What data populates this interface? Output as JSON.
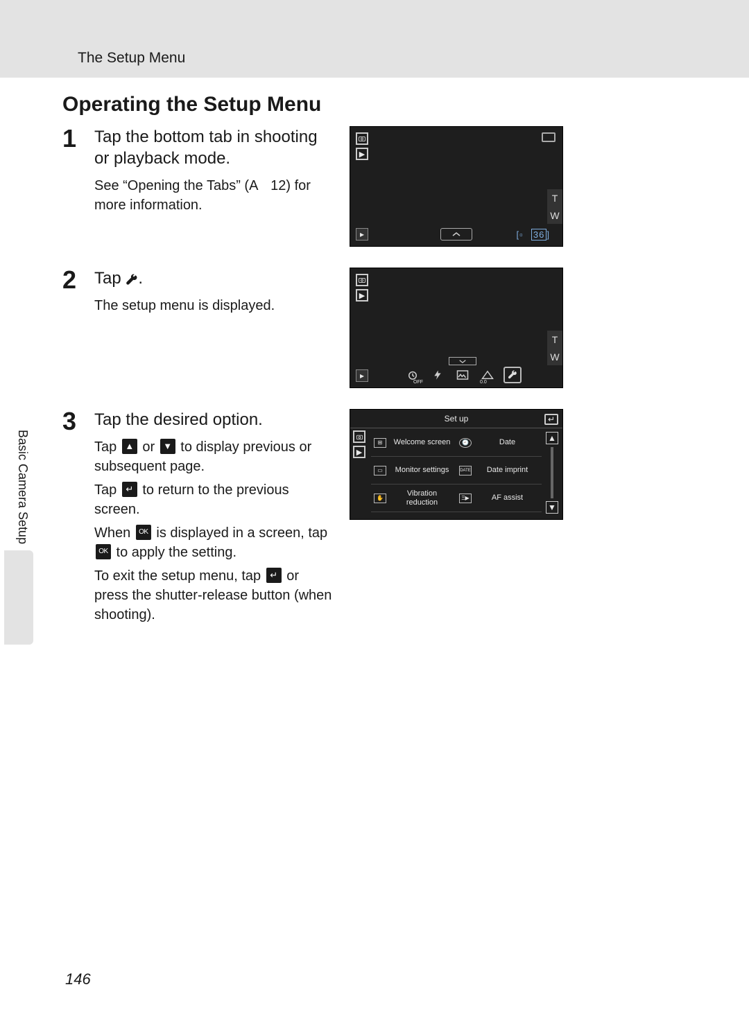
{
  "header": {
    "title": "The Setup Menu"
  },
  "heading": "Operating the Setup Menu",
  "side_tab": "Basic Camera Setup",
  "page_number": "146",
  "steps": [
    {
      "num": "1",
      "title": "Tap the bottom tab in shooting or playback mode.",
      "desc_pre": "See “Opening the Tabs” (",
      "desc_ref": "A",
      "desc_ref_num": "12",
      "desc_post": ") for more information.",
      "screen": {
        "counter_prefix": "[",
        "counter_val": "36",
        "counter_suffix": "]",
        "t": "T",
        "w": "W"
      }
    },
    {
      "num": "2",
      "title_pre": "Tap ",
      "title_post": ".",
      "desc": "The setup menu is displayed.",
      "screen": {
        "t": "T",
        "w": "W",
        "toolbar": [
          "self-timer",
          "flash",
          "mode",
          "exposure",
          "wrench"
        ],
        "exposure_label": "0.0",
        "off_label": "OFF"
      }
    },
    {
      "num": "3",
      "title": "Tap the desired option.",
      "lines": [
        {
          "pre": "Tap ",
          "icon1": "up",
          "mid": " or ",
          "icon2": "down",
          "post": " to display previous or subsequent page."
        },
        {
          "pre": "Tap ",
          "icon1": "back",
          "post": " to return to the previous screen."
        },
        {
          "pre": "When ",
          "icon1": "ok",
          "mid": " is displayed in a screen, tap ",
          "icon2": "ok",
          "post": " to apply the setting."
        },
        {
          "pre": "To exit the setup menu, tap ",
          "icon1": "back",
          "post": " or press the shutter-release button (when shooting)."
        }
      ],
      "screen": {
        "title": "Set up",
        "left": [
          {
            "icon": "welcome",
            "label": "Welcome screen"
          },
          {
            "icon": "monitor",
            "label": "Monitor settings"
          },
          {
            "icon": "vr",
            "label": "Vibration reduction"
          }
        ],
        "right": [
          {
            "icon": "clock",
            "label": "Date"
          },
          {
            "icon": "date",
            "icon_text": "DATE",
            "label": "Date imprint"
          },
          {
            "icon": "af",
            "label": "AF assist"
          }
        ]
      }
    }
  ]
}
